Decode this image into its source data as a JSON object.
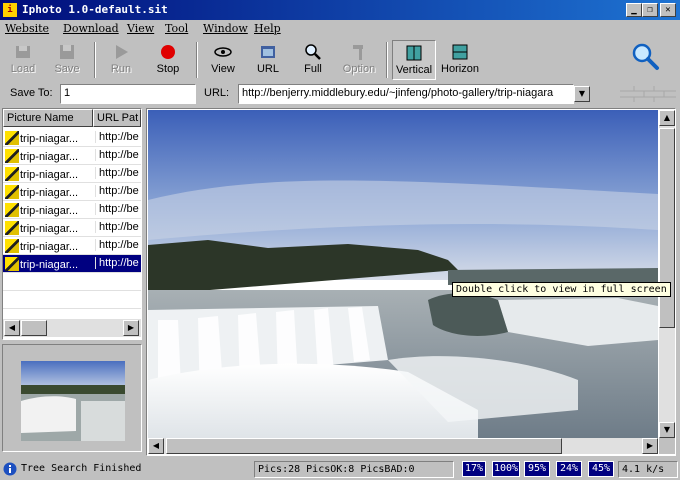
{
  "window": {
    "title": "Iphoto 1.0-default.sit",
    "app_icon_glyph": "i"
  },
  "menu": [
    "Website",
    "Download",
    "View",
    "Tool",
    "Window",
    "Help"
  ],
  "toolbar": {
    "load": "Load",
    "save": "Save",
    "run": "Run",
    "stop": "Stop",
    "view": "View",
    "url": "URL",
    "full": "Full",
    "option": "Option",
    "vertical": "Vertical",
    "horizon": "Horizon"
  },
  "address": {
    "save_to_label": "Save To:",
    "save_to_value": "1",
    "url_label": "URL:",
    "url_value": "http://benjerry.middlebury.edu/~jinfeng/photo-gallery/trip-niagara"
  },
  "list": {
    "columns": [
      "Picture Name",
      "URL Pat"
    ],
    "rows": [
      {
        "name": "trip-niagar...",
        "url": "http://be"
      },
      {
        "name": "trip-niagar...",
        "url": "http://be"
      },
      {
        "name": "trip-niagar...",
        "url": "http://be"
      },
      {
        "name": "trip-niagar...",
        "url": "http://be"
      },
      {
        "name": "trip-niagar...",
        "url": "http://be"
      },
      {
        "name": "trip-niagar...",
        "url": "http://be"
      },
      {
        "name": "trip-niagar...",
        "url": "http://be"
      },
      {
        "name": "trip-niagar...",
        "url": "http://be"
      }
    ],
    "selected_index": 7
  },
  "tooltip": "Double click to view in full screen",
  "status": {
    "message": "Tree Search Finished",
    "counts": "Pics:28 PicsOK:8 PicsBAD:0",
    "percents": [
      "17%",
      "100%",
      "95%",
      "24%",
      "45%"
    ],
    "speed": "4.1 k/s"
  },
  "colors": {
    "title_start": "#000c7a",
    "title_end": "#1e73d2",
    "selection": "#000080",
    "stop_red": "#e00000",
    "tooltip_bg": "#ffffe1"
  }
}
